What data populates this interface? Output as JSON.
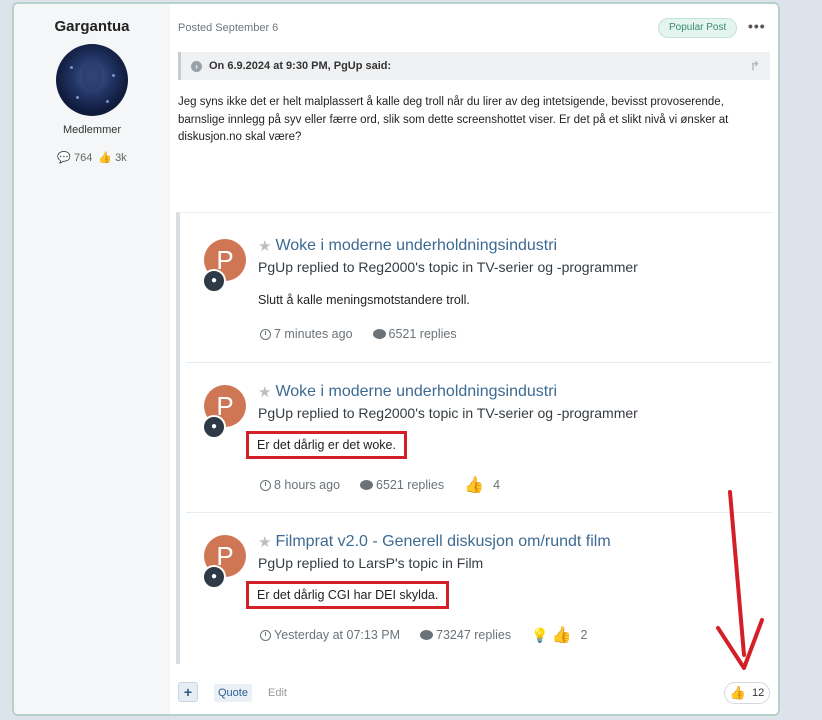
{
  "author": {
    "name": "Gargantua",
    "group": "Medlemmer",
    "posts": "764",
    "reputation": "3k"
  },
  "post": {
    "meta": "Posted September 6",
    "badge": "Popular Post",
    "more": "•••",
    "quote_header": "On 6.9.2024 at 9:30 PM, PgUp said:",
    "body": "Jeg syns ikke det er helt malplassert å kalle deg troll når du lirer av deg intetsigende, bevisst provoserende, barnslige innlegg på syv eller færre ord, slik som dette screenshottet viser. Er det på et slikt nivå vi ønsker at diskusjon.no skal være?"
  },
  "activities": [
    {
      "avatar_letter": "P",
      "title": "Woke i moderne underholdningsindustri",
      "subtitle": "PgUp replied to Reg2000's topic in TV-serier og -programmer",
      "body": "Slutt å kalle meningsmotstandere troll.",
      "time": "7 minutes ago",
      "replies": "6521 replies",
      "reactions": ""
    },
    {
      "avatar_letter": "P",
      "title": "Woke i moderne underholdningsindustri",
      "subtitle": "PgUp replied to Reg2000's topic in TV-serier og -programmer",
      "body": "Er det dårlig er det woke.",
      "time": "8 hours ago",
      "replies": "6521 replies",
      "reactions": "4"
    },
    {
      "avatar_letter": "P",
      "title": "Filmprat v2.0 - Generell diskusjon om/rundt film",
      "subtitle": "PgUp replied to LarsP's topic in Film",
      "body": "Er det dårlig CGI har DEI skylda.",
      "time": "Yesterday at 07:13 PM",
      "replies": "73247 replies",
      "reactions": "2"
    }
  ],
  "footer": {
    "plus": "+",
    "quote": "Quote",
    "edit": "Edit",
    "reaction_count": "12"
  },
  "colors": {
    "annotation_red": "#d31f27",
    "link_blue": "#3d6a93",
    "avatar_orange": "#cf7655",
    "like_green": "#4fa14c"
  }
}
